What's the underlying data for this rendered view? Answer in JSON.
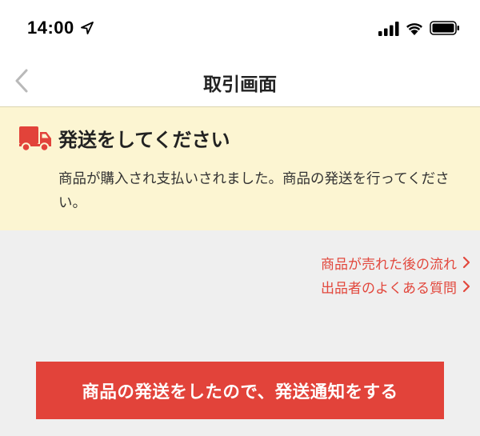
{
  "status_bar": {
    "time": "14:00",
    "icons": [
      "location-arrow-icon",
      "cellular-signal-icon",
      "wifi-icon",
      "battery-icon"
    ]
  },
  "nav": {
    "title": "取引画面",
    "back_icon": "chevron-left-icon"
  },
  "notice": {
    "icon": "truck-icon",
    "title": "発送をしてください",
    "body": "商品が購入され支払いされました。商品の発送を行ってください。"
  },
  "links": [
    {
      "label": "商品が売れた後の流れ",
      "icon": "chevron-right-icon"
    },
    {
      "label": "出品者のよくある質問",
      "icon": "chevron-right-icon"
    }
  ],
  "action": {
    "label": "商品の発送をしたので、発送通知をする"
  },
  "colors": {
    "accent": "#e2433a",
    "link": "#e2483d",
    "notice_background": "#fcf5d2",
    "page_background": "#efefef"
  }
}
